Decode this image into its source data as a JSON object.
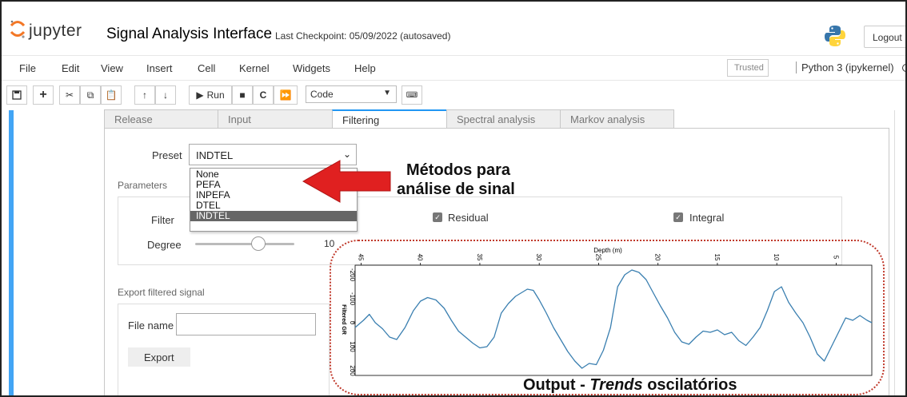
{
  "header": {
    "logo_text": "jupyter",
    "notebook_title": "Signal Analysis Interface",
    "checkpoint": "Last Checkpoint: 05/09/2022  (autosaved)",
    "logout_label": "Logout"
  },
  "menubar": {
    "items": [
      "File",
      "Edit",
      "View",
      "Insert",
      "Cell",
      "Kernel",
      "Widgets",
      "Help"
    ],
    "trusted_label": "Trusted",
    "kernel_name": "Python 3 (ipykernel)"
  },
  "toolbar": {
    "run_label": "Run",
    "cell_type": "Code"
  },
  "tabs": [
    {
      "label": "Release",
      "active": false
    },
    {
      "label": "Input",
      "active": false
    },
    {
      "label": "Filtering",
      "active": true
    },
    {
      "label": "Spectral analysis",
      "active": false
    },
    {
      "label": "Markov analysis",
      "active": false
    }
  ],
  "filtering": {
    "preset_label": "Preset",
    "preset_value": "INDTEL",
    "preset_options": [
      "None",
      "PEFA",
      "INPEFA",
      "DTEL",
      "INDTEL"
    ],
    "preset_selected_index": 4,
    "parameters_label": "Parameters",
    "filter_label": "Filter",
    "degree_label": "Degree",
    "degree_value": "10",
    "degree_fraction": 0.55,
    "residual_label": "Residual",
    "residual_checked": true,
    "integral_label": "Integral",
    "integral_checked": true,
    "export_section_label": "Export filtered signal",
    "file_name_label": "File name",
    "file_name_value": "",
    "export_button_label": "Export"
  },
  "annotations": {
    "methods_line1": "Métodos para",
    "methods_line2": "análise de sinal",
    "output_prefix": "Output - ",
    "output_italic": "Trends",
    "output_suffix": " oscilatórios",
    "arrow_color": "#e02020",
    "oval_color": "#c0392b"
  },
  "chart_data": {
    "type": "line",
    "xlabel": "Depth (m)",
    "ylabel": "Filtered GR",
    "x_ticks": [
      45,
      40,
      35,
      30,
      25,
      20,
      15,
      10,
      5
    ],
    "x_range": [
      45.5,
      2
    ],
    "x_inverted": true,
    "y_ticks": [
      -200,
      -100,
      0,
      100,
      200
    ],
    "y_range": [
      -240,
      220
    ],
    "y_inverted": true,
    "line_color": "#3a7fb0",
    "series": [
      {
        "x": [
          45.5,
          44.8,
          44.3,
          43.8,
          43.2,
          42.6,
          42.0,
          41.3,
          40.6,
          40.0,
          39.4,
          38.7,
          38.0,
          37.4,
          36.8,
          36.2,
          35.6,
          35.0,
          34.4,
          33.8,
          33.2,
          32.6,
          32.0,
          31.5,
          31.0,
          30.5,
          30.0,
          29.4,
          28.8,
          28.2,
          27.6,
          27.0,
          26.4,
          25.8,
          25.2,
          24.6,
          24.0,
          23.4,
          22.8,
          22.2,
          21.6,
          21.0,
          20.4,
          19.8,
          19.2,
          18.6,
          18.0,
          17.4,
          16.8,
          16.2,
          15.6,
          15.0,
          14.4,
          13.8,
          13.2,
          12.6,
          12.0,
          11.4,
          10.8,
          10.2,
          9.6,
          9.0,
          8.4,
          7.8,
          7.2,
          6.6,
          6.0,
          5.4,
          4.8,
          4.2,
          3.6,
          3.0,
          2.4,
          2.0
        ],
        "y": [
          20,
          -10,
          -35,
          0,
          25,
          60,
          70,
          20,
          -50,
          -90,
          -105,
          -95,
          -60,
          -10,
          35,
          60,
          85,
          105,
          100,
          60,
          -40,
          -80,
          -110,
          -125,
          -140,
          -135,
          -95,
          -40,
          20,
          70,
          120,
          160,
          190,
          170,
          175,
          115,
          20,
          -150,
          -200,
          -220,
          -210,
          -180,
          -125,
          -70,
          -20,
          40,
          80,
          90,
          60,
          35,
          40,
          30,
          50,
          40,
          75,
          95,
          60,
          20,
          -50,
          -130,
          -150,
          -85,
          -40,
          0,
          60,
          130,
          160,
          100,
          40,
          -20,
          -10,
          -30,
          -10,
          0
        ]
      }
    ]
  }
}
